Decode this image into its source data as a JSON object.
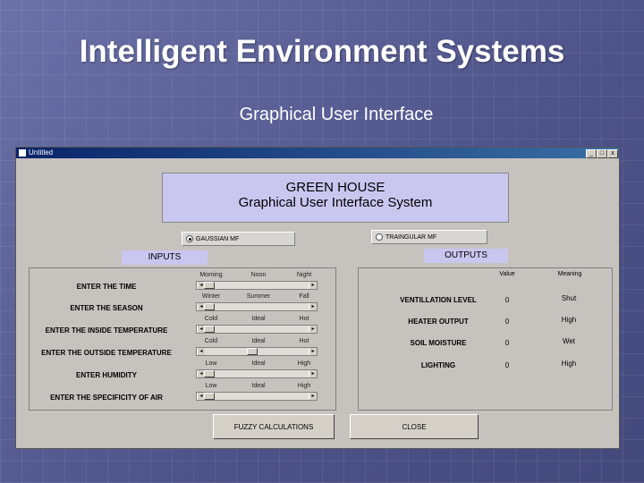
{
  "slide": {
    "title": "Intelligent  Environment Systems",
    "subtitle": "Graphical User Interface"
  },
  "window": {
    "title": "Untitled",
    "controls": [
      "_",
      "□",
      "x"
    ]
  },
  "header": {
    "line1": "GREEN HOUSE",
    "line2": "Graphical User Interface System"
  },
  "mf_options": [
    {
      "label": "GAUSSIAN MF",
      "selected": true
    },
    {
      "label": "TRAINGULAR MF",
      "selected": false
    }
  ],
  "inputs": {
    "title": "INPUTS",
    "rows": [
      {
        "label": "ENTER THE TIME",
        "ticks": [
          "Morning",
          "Noon",
          "Night"
        ],
        "level": 0.0
      },
      {
        "label": "ENTER THE SEASON",
        "ticks": [
          "Winter",
          "Summer",
          "Fall"
        ],
        "level": 0.0
      },
      {
        "label": "ENTER THE INSIDE TEMPERATURE",
        "ticks": [
          "Cold",
          "Ideal",
          "Hot"
        ],
        "level": 0.0
      },
      {
        "label": "ENTER THE OUTSIDE TEMPERATURE",
        "ticks": [
          "Cold",
          "Ideal",
          "Hot"
        ],
        "level": 0.45
      },
      {
        "label": "ENTER HUMIDITY",
        "ticks": [
          "Low",
          "Ideal",
          "High"
        ],
        "level": 0.0
      },
      {
        "label": "ENTER THE SPECIFICITY OF AIR",
        "ticks": [
          "Low",
          "Ideal",
          "High"
        ],
        "level": 0.0
      }
    ]
  },
  "outputs": {
    "title": "OUTPUTS",
    "col_value": "Value",
    "col_meaning": "Meaning",
    "rows": [
      {
        "label": "VENTILLATION LEVEL",
        "value": "0",
        "meaning": "Shut"
      },
      {
        "label": "HEATER OUTPUT",
        "value": "0",
        "meaning": "High"
      },
      {
        "label": "SOIL MOISTURE",
        "value": "0",
        "meaning": "Wet"
      },
      {
        "label": "LIGHTING",
        "value": "0",
        "meaning": "High"
      }
    ]
  },
  "buttons": {
    "fuzzy": "FUZZY CALCULATIONS",
    "close": "CLOSE"
  },
  "colors": {
    "background": "#5a5f93",
    "header_fill": "#c9c7f0",
    "window_fill": "#c6c3bf",
    "titlebar": "#0a246a"
  }
}
